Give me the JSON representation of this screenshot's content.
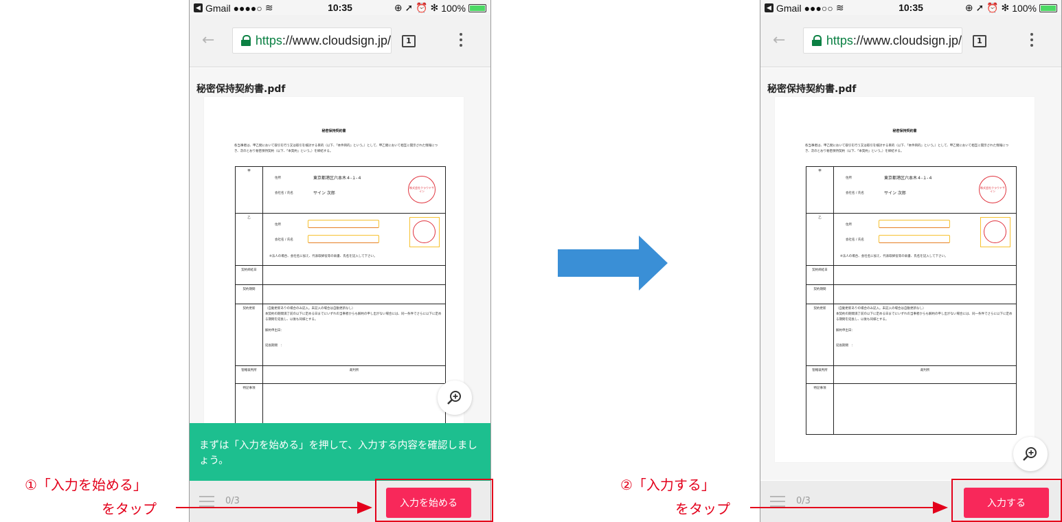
{
  "status_bar": {
    "back_app": "Gmail",
    "time": "10:35",
    "battery": "100%",
    "signal_left": "●●●●○",
    "signal_right": "●●●○○",
    "icons": "⊕ ➚ ⏰ ✻"
  },
  "browser": {
    "url_scheme": "https",
    "url_rest": "://www.cloudsign.jp/",
    "tabs_count": "1"
  },
  "document": {
    "filename": "秘密保持契約書.pdf",
    "title": "秘密保持契約書",
    "intro": "各当事者は、甲乙間において取引を行う又は取引を検討する目的（以下、「本件目的」という。）として、甲乙間において相互に開示された情報につき、次のとおり秘密保持契約（以下、「本契約」という。）を締結する。",
    "label_ko": "甲",
    "label_otsu": "乙",
    "address_label": "住所",
    "address_value": "東京都港区六本木４-１-４",
    "name_label": "会社名 / 氏名",
    "name_value": "サイン 次郎",
    "seal_text": "株式会社クラウドサイン",
    "otsu_note": "※法人の場合、会社名に加え、代表取締役等の肩書、氏名を記入して下さい。",
    "label_date": "契約締結日",
    "label_period": "契約期間",
    "label_renew": "契約更新",
    "renew_text": "（自動更新ありの場合のみ記入。未記入の場合は自動更新なし）\n本契約の期間満了前の以下に定める日までにいずれの当事者からも解約の申し出がない場合には、同一条件でさらに以下に定める期間を延長し、以後も同様とする。",
    "renew_notice": "解約申出日：",
    "renew_extend": "延長期間　：",
    "label_court": "管轄裁判所",
    "court_value": "裁判所",
    "label_special": "特記事項"
  },
  "screen1": {
    "tooltip": "まずは「入力を始める」を押して、入力する内容を確認しましょう。",
    "page_count": "0/3",
    "button": "入力を始める"
  },
  "screen2": {
    "page_count": "0/3",
    "button": "入力する"
  },
  "annotations": {
    "step1_line1": "①「入力を始める」",
    "step1_line2": "をタップ",
    "step2_line1": "②「入力する」",
    "step2_line2": "をタップ"
  },
  "colors": {
    "accent_red": "#e3001b",
    "button_pink": "#f8285a",
    "tooltip_green": "#1dbf8f",
    "arrow_blue": "#3a8fd6"
  }
}
